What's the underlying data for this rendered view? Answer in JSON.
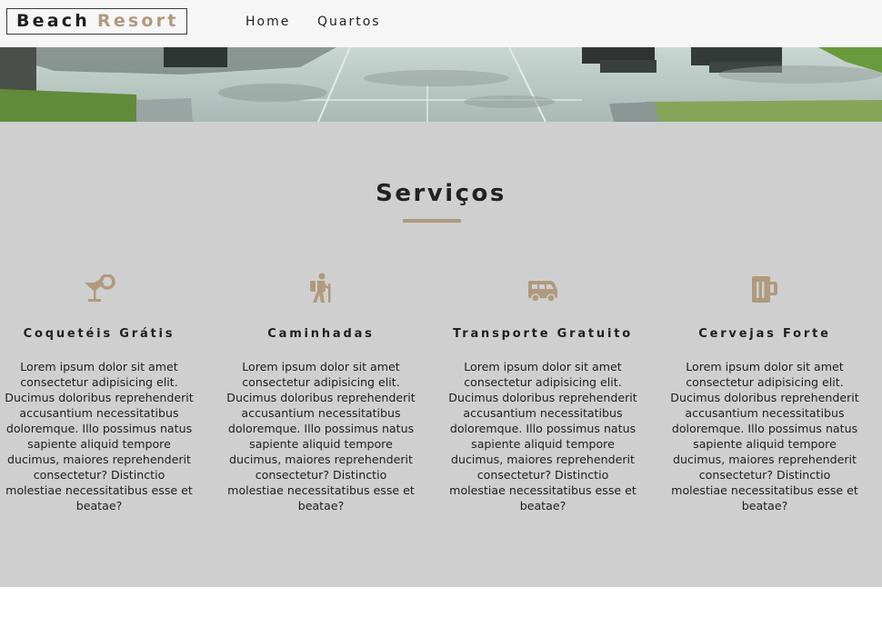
{
  "brand": {
    "word1": "Beach",
    "word2": "Resort"
  },
  "nav": {
    "home": "Home",
    "rooms": "Quartos"
  },
  "colors": {
    "accent": "#af9a7d",
    "section_bg": "#cfcfcf",
    "navbar_bg": "#f6f6f6"
  },
  "services": {
    "title": "Serviços",
    "items": [
      {
        "icon": "cocktail-icon",
        "title": "Coquetéis Grátis",
        "text": "Lorem ipsum dolor sit amet consectetur adipisicing elit. Ducimus doloribus reprehenderit accusantium necessitatibus doloremque. Illo possimus natus sapiente aliquid tempore ducimus, maiores reprehenderit consectetur? Distinctio molestiae necessitatibus esse et beatae?"
      },
      {
        "icon": "hiking-icon",
        "title": "Caminhadas",
        "text": "Lorem ipsum dolor sit amet consectetur adipisicing elit. Ducimus doloribus reprehenderit accusantium necessitatibus doloremque. Illo possimus natus sapiente aliquid tempore ducimus, maiores reprehenderit consectetur? Distinctio molestiae necessitatibus esse et beatae?"
      },
      {
        "icon": "shuttle-van-icon",
        "title": "Transporte Gratuito",
        "text": "Lorem ipsum dolor sit amet consectetur adipisicing elit. Ducimus doloribus reprehenderit accusantium necessitatibus doloremque. Illo possimus natus sapiente aliquid tempore ducimus, maiores reprehenderit consectetur? Distinctio molestiae necessitatibus esse et beatae?"
      },
      {
        "icon": "beer-icon",
        "title": "Cervejas Forte",
        "text": "Lorem ipsum dolor sit amet consectetur adipisicing elit. Ducimus doloribus reprehenderit accusantium necessitatibus doloremque. Illo possimus natus sapiente aliquid tempore ducimus, maiores reprehenderit consectetur? Distinctio molestiae necessitatibus esse et beatae?"
      }
    ]
  }
}
